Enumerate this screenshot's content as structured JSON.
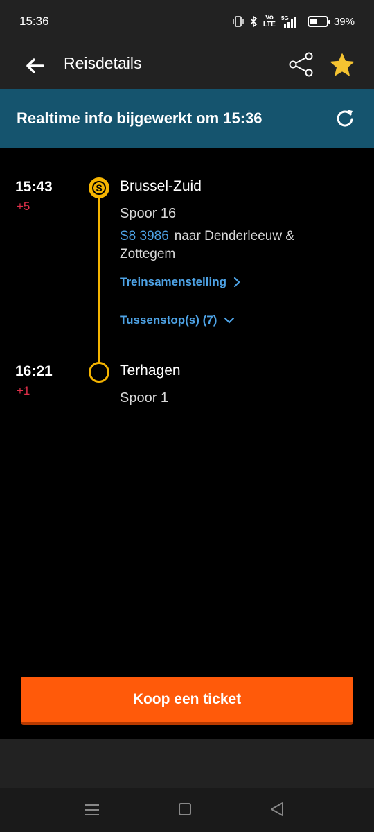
{
  "statusbar": {
    "time": "15:36",
    "volte": "Vo\nLTE",
    "network": "5G",
    "battery_percent": "39%",
    "battery_level": 0.39
  },
  "appbar": {
    "title": "Reisdetails",
    "icons": [
      "back-arrow-icon",
      "share-icon",
      "star-icon"
    ],
    "star_color": "#f5c331"
  },
  "banner": {
    "text": "Realtime info bijgewerkt om 15:36",
    "background": "#15546e"
  },
  "journey": {
    "departure": {
      "time": "15:43",
      "delay": "+5",
      "station": "Brussel-Zuid",
      "platform": "Spoor 16",
      "train_code": "S8 3986",
      "destination": "naar Denderleeuw & Zottegem",
      "composition_link": "Treinsamenstelling",
      "stops_link": "Tussenstop(s) (7)"
    },
    "arrival": {
      "time": "16:21",
      "delay": "+1",
      "station": "Terhagen",
      "platform": "Spoor 1"
    },
    "line_color": "#f5b400",
    "delay_color": "#e0304a",
    "link_color": "#4ea3e6"
  },
  "ticket_button": {
    "label": "Koop een ticket",
    "color": "#ff5a0a"
  },
  "navbar": {
    "icons": [
      "menu-icon",
      "home-icon",
      "back-icon"
    ]
  }
}
